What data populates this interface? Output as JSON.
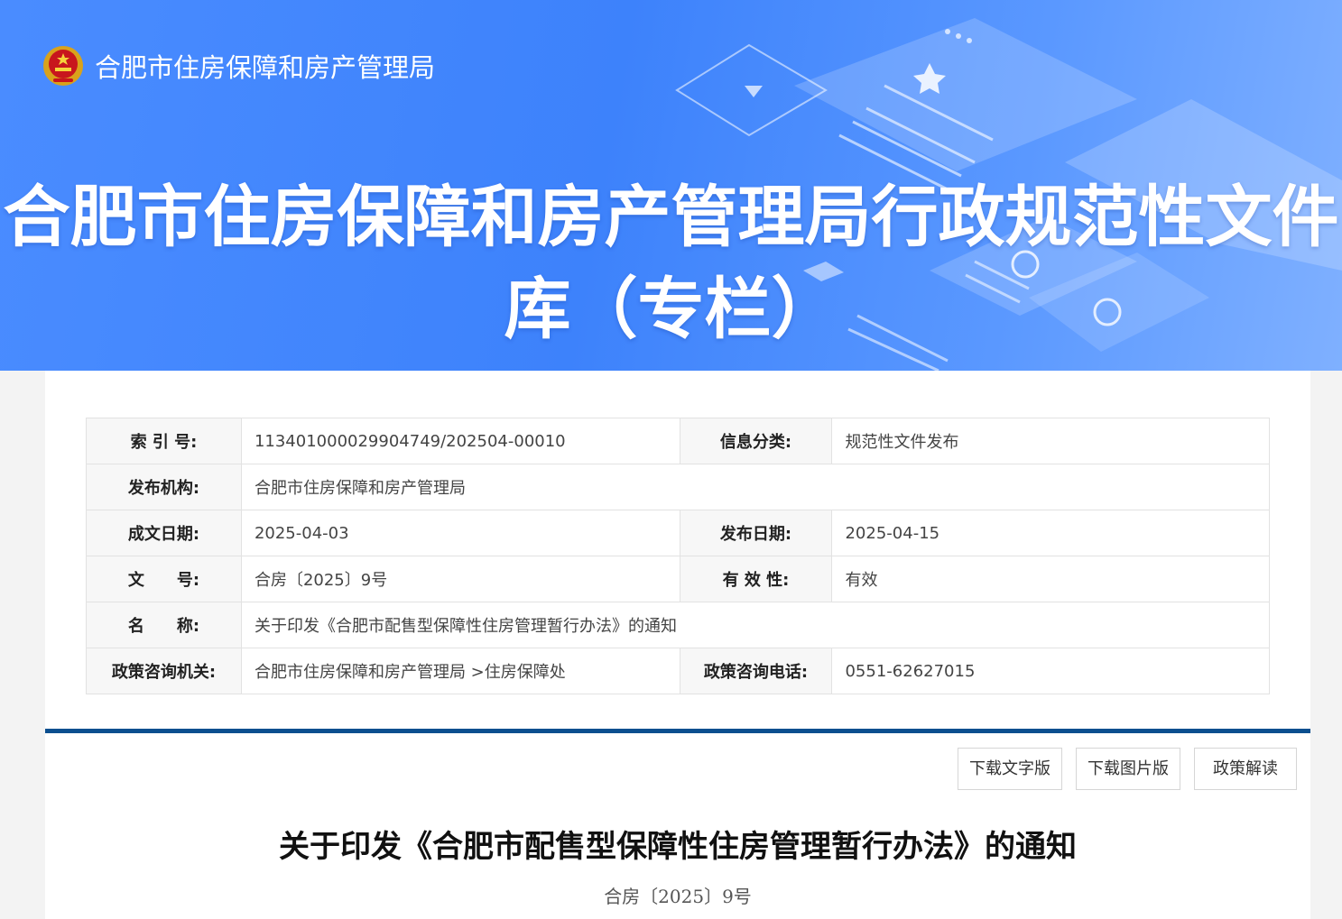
{
  "header": {
    "site_name": "合肥市住房保障和房产管理局",
    "banner_title_line1": "合肥市住房保障和房产管理局行政规范性文件",
    "banner_title_line2": "库（专栏）"
  },
  "meta": {
    "index_label": "索 引 号:",
    "index_value": "11340100002990​4749/202504-00010",
    "category_label": "信息分类:",
    "category_value": "规范性文件发布",
    "publisher_label": "发布机构:",
    "publisher_value": "合肥市住房保障和房产管理局",
    "written_date_label": "成文日期:",
    "written_date_value": "2025-04-03",
    "publish_date_label": "发布日期:",
    "publish_date_value": "2025-04-15",
    "doc_no_label": "文　　号:",
    "doc_no_value": "合房〔2025〕9号",
    "validity_label": "有 效 性:",
    "validity_value": "有效",
    "name_label": "名　　称:",
    "name_value": "关于印发《合肥市配售型保障性住房管理暂行办法》的通知",
    "consult_org_label": "政策咨询机关:",
    "consult_org_value": "合肥市住房保障和房产管理局 >住房保障处",
    "consult_phone_label": "政策咨询电话:",
    "consult_phone_value": "0551-62627015"
  },
  "actions": {
    "download_text": "下载文字版",
    "download_image": "下载图片版",
    "policy_interpretation": "政策解读"
  },
  "document": {
    "title": "关于印发《合肥市配售型保障性住房管理暂行办法》的通知",
    "number": "合房〔2025〕9号"
  },
  "colors": {
    "banner_blue": "#4a8cff",
    "divider_blue": "#0b4f8f"
  },
  "icons": [
    "national-emblem-icon"
  ]
}
